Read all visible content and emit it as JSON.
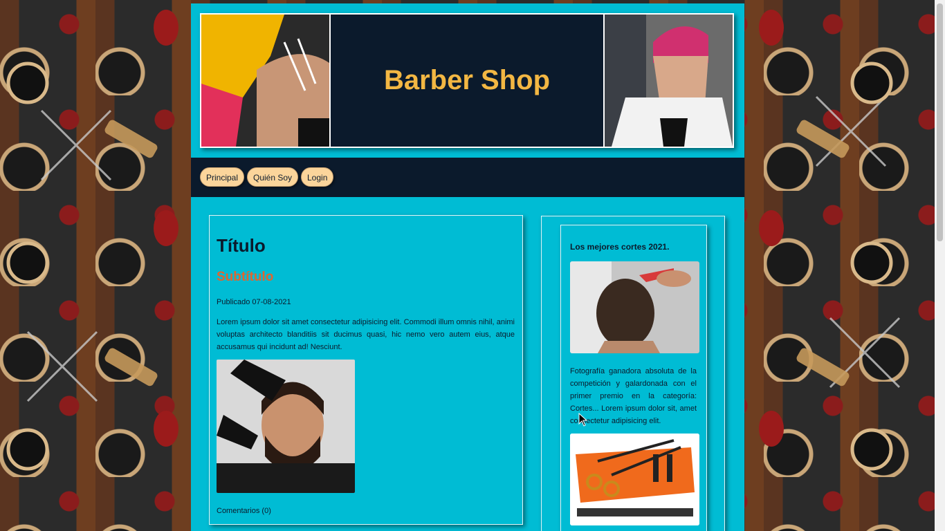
{
  "header": {
    "site_title": "Barber Shop"
  },
  "nav": {
    "items": [
      {
        "label": "Principal"
      },
      {
        "label": "Quién Soy"
      },
      {
        "label": "Login"
      }
    ]
  },
  "post": {
    "title": "Título",
    "subtitle": "Subtítulo",
    "published": "Publicado 07-08-2021",
    "body": "Lorem ipsum dolor sit amet consectetur adipisicing elit. Commodi illum omnis nihil, animi voluptas architecto blanditiis sit ducimus quasi, hic nemo vero autem eius, atque accusamus qui incidunt ad! Nesciunt.",
    "comments": "Comentarios (0)"
  },
  "aside": {
    "title": "Los mejores cortes 2021.",
    "text": "Fotografía ganadora absoluta de la competición y galardonada con el primer premio en la categoría: Cortes... Lorem ipsum dolor sit, amet consectetur adipisicing elit."
  },
  "colors": {
    "page_bg": "#00bcd4",
    "dark": "#0b1a2c",
    "title_gold": "#f3b743",
    "subtitle_orange": "#e0652f",
    "nav_button": "#fbd59b"
  }
}
